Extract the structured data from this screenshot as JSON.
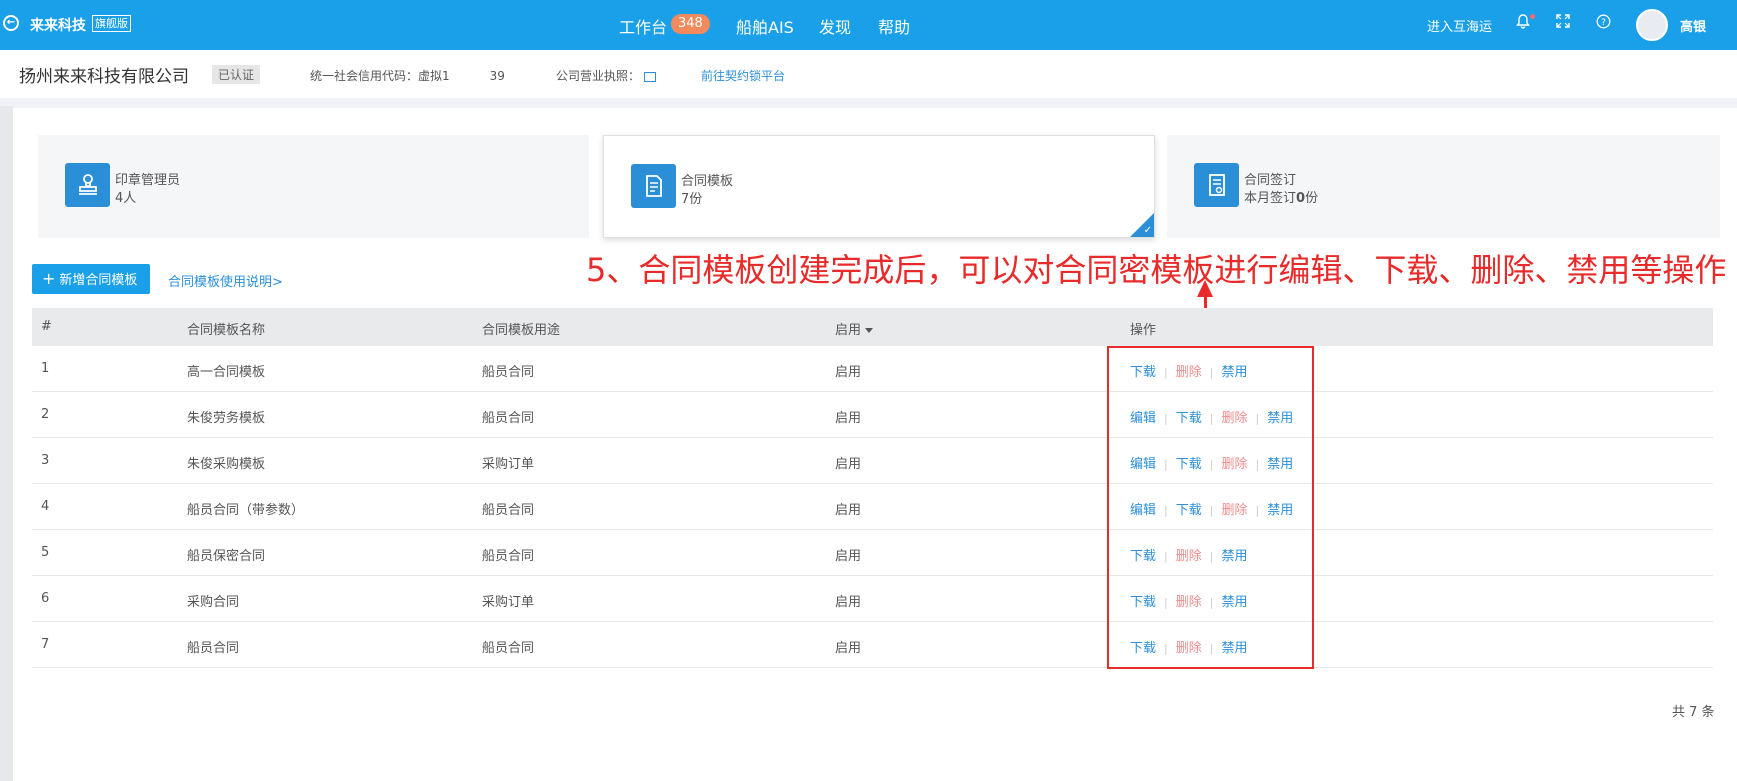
{
  "topbar": {
    "brand": "来来科技",
    "brand_tag": "旗舰版",
    "nav": [
      {
        "label": "工作台",
        "badge": "348"
      },
      {
        "label": "船舶AIS"
      },
      {
        "label": "发现"
      },
      {
        "label": "帮助"
      }
    ],
    "enter_label": "进入互海运",
    "username": "高银"
  },
  "company": {
    "name": "扬州来来科技有限公司",
    "status": "已认证",
    "credit_label": "统一社会信用代码：虚拟1",
    "credit_suffix": "39",
    "license_label": "公司营业执照：",
    "platform_link": "前往契约锁平台"
  },
  "cards": [
    {
      "title": "印章管理员",
      "sub": "4人"
    },
    {
      "title": "合同模板",
      "sub": "7份"
    },
    {
      "title": "合同签订",
      "sub_prefix": "本月签订",
      "sub_num": "0",
      "sub_suffix": "份"
    }
  ],
  "add_button": "新增合同模板",
  "help_link": "合同模板使用说明>",
  "annotation": "5、合同模板创建完成后，可以对合同密模板进行编辑、下载、删除、禁用等操作",
  "table": {
    "headers": [
      "#",
      "合同模板名称",
      "合同模板用途",
      "启用",
      "操作"
    ],
    "rows": [
      {
        "num": "1",
        "name": "高一合同模板",
        "purpose": "船员合同",
        "status": "启用",
        "ops": [
          "下载",
          "删除",
          "禁用"
        ]
      },
      {
        "num": "2",
        "name": "朱俊劳务模板",
        "purpose": "船员合同",
        "status": "启用",
        "ops": [
          "编辑",
          "下载",
          "删除",
          "禁用"
        ]
      },
      {
        "num": "3",
        "name": "朱俊采购模板",
        "purpose": "采购订单",
        "status": "启用",
        "ops": [
          "编辑",
          "下载",
          "删除",
          "禁用"
        ]
      },
      {
        "num": "4",
        "name": "船员合同（带参数）",
        "purpose": "船员合同",
        "status": "启用",
        "ops": [
          "编辑",
          "下载",
          "删除",
          "禁用"
        ]
      },
      {
        "num": "5",
        "name": "船员保密合同",
        "purpose": "船员合同",
        "status": "启用",
        "ops": [
          "下载",
          "删除",
          "禁用"
        ]
      },
      {
        "num": "6",
        "name": "采购合同",
        "purpose": "采购订单",
        "status": "启用",
        "ops": [
          "下载",
          "删除",
          "禁用"
        ]
      },
      {
        "num": "7",
        "name": "船员合同",
        "purpose": "船员合同",
        "status": "启用",
        "ops": [
          "下载",
          "删除",
          "禁用"
        ]
      }
    ]
  },
  "footer_total": "共 7 条",
  "colors": {
    "accent": "#1aa0e8",
    "link": "#2b8fd8",
    "danger": "#f08c8c",
    "annotation": "#e82a2a"
  }
}
